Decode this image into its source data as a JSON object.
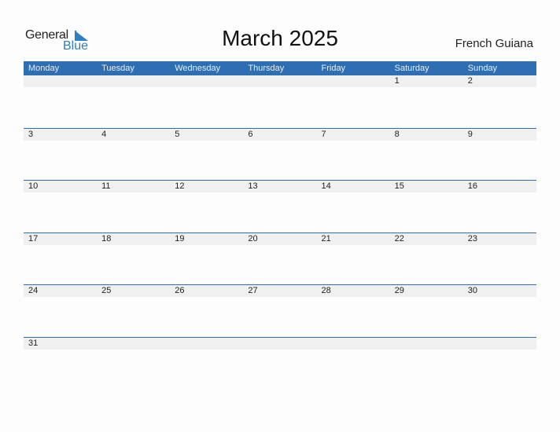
{
  "logo": {
    "general": "General",
    "blue": "Blue"
  },
  "title": "March 2025",
  "region": "French Guiana",
  "weekdays": [
    "Monday",
    "Tuesday",
    "Wednesday",
    "Thursday",
    "Friday",
    "Saturday",
    "Sunday"
  ],
  "weeks": [
    [
      "",
      "",
      "",
      "",
      "",
      "1",
      "2"
    ],
    [
      "3",
      "4",
      "5",
      "6",
      "7",
      "8",
      "9"
    ],
    [
      "10",
      "11",
      "12",
      "13",
      "14",
      "15",
      "16"
    ],
    [
      "17",
      "18",
      "19",
      "20",
      "21",
      "22",
      "23"
    ],
    [
      "24",
      "25",
      "26",
      "27",
      "28",
      "29",
      "30"
    ],
    [
      "31",
      "",
      "",
      "",
      "",
      "",
      ""
    ]
  ],
  "colors": {
    "accent": "#2e6fb3",
    "logo_blue": "#2f7fc8"
  }
}
